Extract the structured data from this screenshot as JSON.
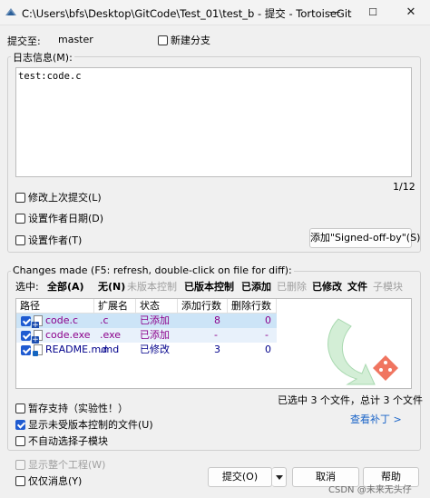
{
  "window": {
    "title": "C:\\Users\\bfs\\Desktop\\GitCode\\Test_01\\test_b - 提交 - TortoiseGit",
    "min": "—",
    "max": "☐",
    "close": "✕"
  },
  "commit_to": {
    "label": "提交至:",
    "branch": "master",
    "new_branch_label": "新建分支"
  },
  "log": {
    "group_label": "日志信息(M):",
    "message": "test:code.c",
    "counter": "1/12"
  },
  "options": {
    "amend": "修改上次提交(L)",
    "set_date": "设置作者日期(D)",
    "set_author": "设置作者(T)",
    "signoff_button": "添加\"Signed-off-by\"(S)"
  },
  "changes": {
    "group_label": "Changes made (F5: refresh, double-click on file for diff):",
    "select_label": "选中:",
    "filters": {
      "all": "全部(A)",
      "none": "无(N)",
      "unversioned": "未版本控制",
      "versioned": "已版本控制",
      "added": "已添加",
      "deleted": "已删除",
      "modified": "已修改",
      "files": "文件",
      "submodules": "子模块"
    },
    "columns": [
      "路径",
      "扩展名",
      "状态",
      "添加行数",
      "删除行数"
    ],
    "rows": [
      {
        "path": "code.c",
        "ext": ".c",
        "status": "已添加",
        "added": "8",
        "deleted": "0"
      },
      {
        "path": "code.exe",
        "ext": ".exe",
        "status": "已添加",
        "added": "-",
        "deleted": "-"
      },
      {
        "path": "README.md",
        "ext": ".md",
        "status": "已修改",
        "added": "3",
        "deleted": "0"
      }
    ],
    "summary": "已选中 3 个文件，总计 3 个文件",
    "view_patch": "查看补丁 >"
  },
  "bottom": {
    "stash": "暂存支持（实验性！）",
    "show_unversioned": "显示未受版本控制的文件(U)",
    "no_autoselect": "不自动选择子模块",
    "show_whole": "显示整个工程(W)",
    "message_only": "仅仅消息(Y)",
    "commit": "提交(O)",
    "cancel": "取消",
    "help": "帮助"
  },
  "watermark": "CSDN @未来无头仔",
  "colors": {
    "added": "#8b008b",
    "modified": "#00008b",
    "link": "#1a64c8",
    "select_bg": "#cce4f7"
  }
}
